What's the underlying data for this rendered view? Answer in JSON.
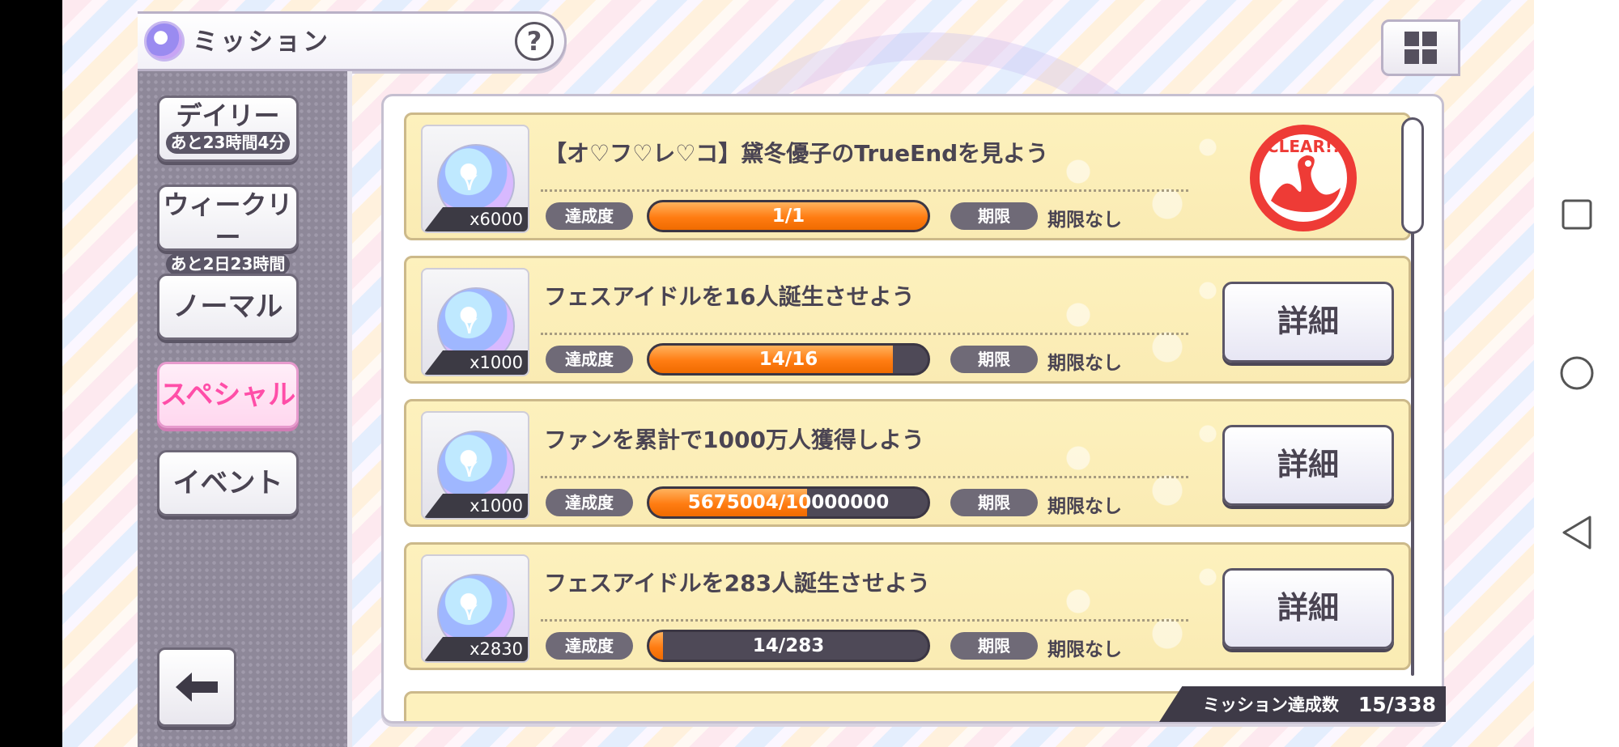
{
  "header": {
    "title": "ミッション",
    "help_label": "?"
  },
  "tabs": [
    {
      "label": "デイリー",
      "sub": "あと23時間4分",
      "active": false
    },
    {
      "label": "ウィークリー",
      "sub": "あと2日23時間",
      "active": false
    },
    {
      "label": "ノーマル",
      "sub": "",
      "active": true
    },
    {
      "label": "スペシャル",
      "sub": "",
      "active": true
    },
    {
      "label": "イベント",
      "sub": "",
      "active": false
    }
  ],
  "labels": {
    "progress": "達成度",
    "deadline": "期限",
    "detail": "詳細",
    "clear": "CLEAR!!"
  },
  "missions": [
    {
      "title": "【オ♡フ♡レ♡コ】黛冬優子のTrueEndを見よう",
      "reward": "x6000",
      "progress_text": "1/1",
      "progress": 1.0,
      "deadline": "期限なし",
      "status": "clear"
    },
    {
      "title": "フェスアイドルを16人誕生させよう",
      "reward": "x1000",
      "progress_text": "14/16",
      "progress": 0.875,
      "deadline": "期限なし",
      "status": "detail"
    },
    {
      "title": "ファンを累計で1000万人獲得しよう",
      "reward": "x1000",
      "progress_text": "5675004/10000000",
      "progress": 0.5675,
      "deadline": "期限なし",
      "status": "detail"
    },
    {
      "title": "フェスアイドルを283人誕生させよう",
      "reward": "x2830",
      "progress_text": "14/283",
      "progress": 0.049,
      "deadline": "期限なし",
      "status": "detail"
    }
  ],
  "footer": {
    "label": "ミッション達成数",
    "value": "15/338"
  },
  "colors": {
    "accent": "#ff4ea8",
    "progress": "#ff7c12",
    "clear": "#ee3b36"
  },
  "icons": {
    "menu": "grid-icon",
    "back": "arrow-left-icon",
    "android_nav": [
      "square-icon",
      "circle-icon",
      "triangle-back-icon"
    ]
  }
}
